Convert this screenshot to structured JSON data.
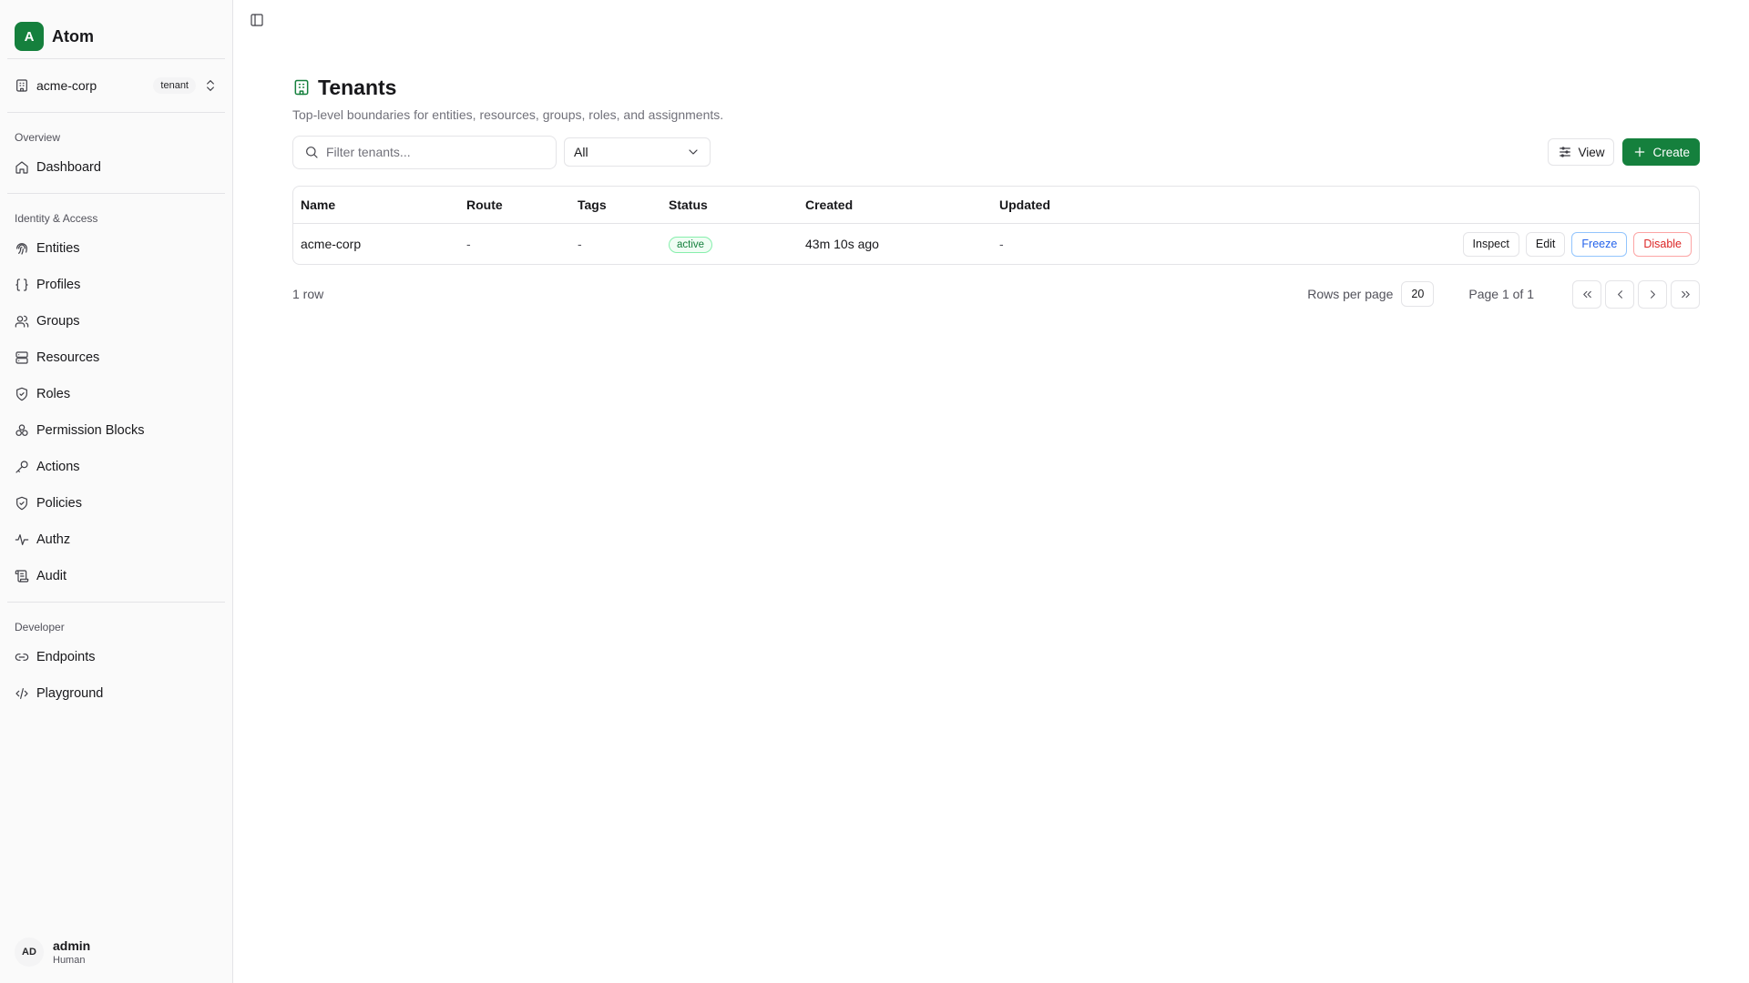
{
  "app": {
    "logo_letter": "A",
    "name": "Atom"
  },
  "tenant_switcher": {
    "name": "acme-corp",
    "badge": "tenant"
  },
  "nav": {
    "sections": [
      {
        "label": "Overview",
        "items": [
          {
            "label": "Dashboard",
            "icon": "home-icon"
          }
        ]
      },
      {
        "label": "Identity & Access",
        "items": [
          {
            "label": "Entities",
            "icon": "fingerprint-icon"
          },
          {
            "label": "Profiles",
            "icon": "braces-icon"
          },
          {
            "label": "Groups",
            "icon": "users-icon"
          },
          {
            "label": "Resources",
            "icon": "server-icon"
          },
          {
            "label": "Roles",
            "icon": "shield-icon"
          },
          {
            "label": "Permission Blocks",
            "icon": "blocks-icon"
          },
          {
            "label": "Actions",
            "icon": "key-icon"
          },
          {
            "label": "Policies",
            "icon": "shield-check-icon"
          },
          {
            "label": "Authz",
            "icon": "activity-icon"
          },
          {
            "label": "Audit",
            "icon": "scroll-icon"
          }
        ]
      },
      {
        "label": "Developer",
        "items": [
          {
            "label": "Endpoints",
            "icon": "link-icon"
          },
          {
            "label": "Playground",
            "icon": "code-icon"
          }
        ]
      }
    ]
  },
  "user": {
    "initials": "AD",
    "name": "admin",
    "role": "Human"
  },
  "page": {
    "title": "Tenants",
    "subtitle": "Top-level boundaries for entities, resources, groups, roles, and assignments.",
    "search_placeholder": "Filter tenants...",
    "filter_value": "All",
    "view_label": "View",
    "create_label": "Create"
  },
  "table": {
    "columns": [
      "Name",
      "Route",
      "Tags",
      "Status",
      "Created",
      "Updated"
    ],
    "rows": [
      {
        "name": "acme-corp",
        "route": "-",
        "tags": "-",
        "status": "active",
        "created": "43m 10s ago",
        "updated": "-",
        "actions": [
          "Inspect",
          "Edit",
          "Freeze",
          "Disable"
        ]
      }
    ]
  },
  "pagination": {
    "row_count": "1 row",
    "rows_per_page_label": "Rows per page",
    "rows_per_page": "20",
    "page_info": "Page 1 of 1"
  },
  "colors": {
    "accent": "#15803d",
    "freeze": "#2563eb",
    "disable": "#dc2626"
  }
}
